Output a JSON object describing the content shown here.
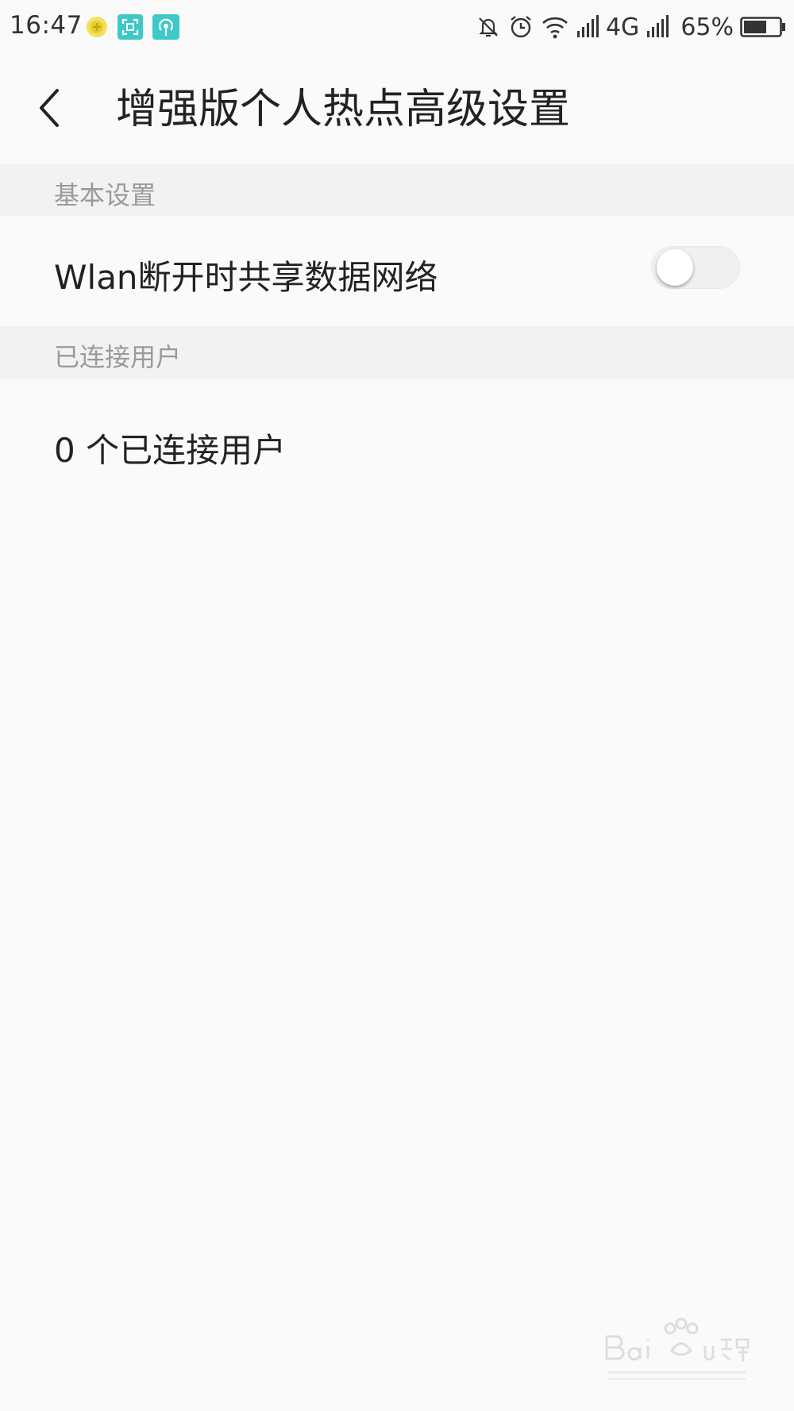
{
  "status_bar": {
    "time": "16:47",
    "network_type": "4G",
    "battery_percent": "65%",
    "battery_level": 0.65,
    "left_icons": [
      "coin-app-icon",
      "scan-app-icon",
      "hotspot-app-icon"
    ],
    "right_icons": [
      "mute-icon",
      "alarm-icon",
      "wifi-icon",
      "signal-icon",
      "signal-icon",
      "battery-icon"
    ]
  },
  "header": {
    "title": "增强版个人热点高级设置",
    "back_icon": "back-arrow-icon"
  },
  "sections": {
    "basic": {
      "header": "基本设置",
      "wlan_share": {
        "label": "Wlan断开时共享数据网络",
        "enabled": false
      }
    },
    "connected": {
      "header": "已连接用户",
      "count_text": "0 个已连接用户"
    }
  },
  "colors": {
    "background": "#fafafa",
    "section_bg": "#f2f2f2",
    "section_text": "#9a9a9a",
    "primary_text": "#222222",
    "app_icon_teal": "#3ec9c9",
    "coin_yellow": "#f2e05a"
  }
}
